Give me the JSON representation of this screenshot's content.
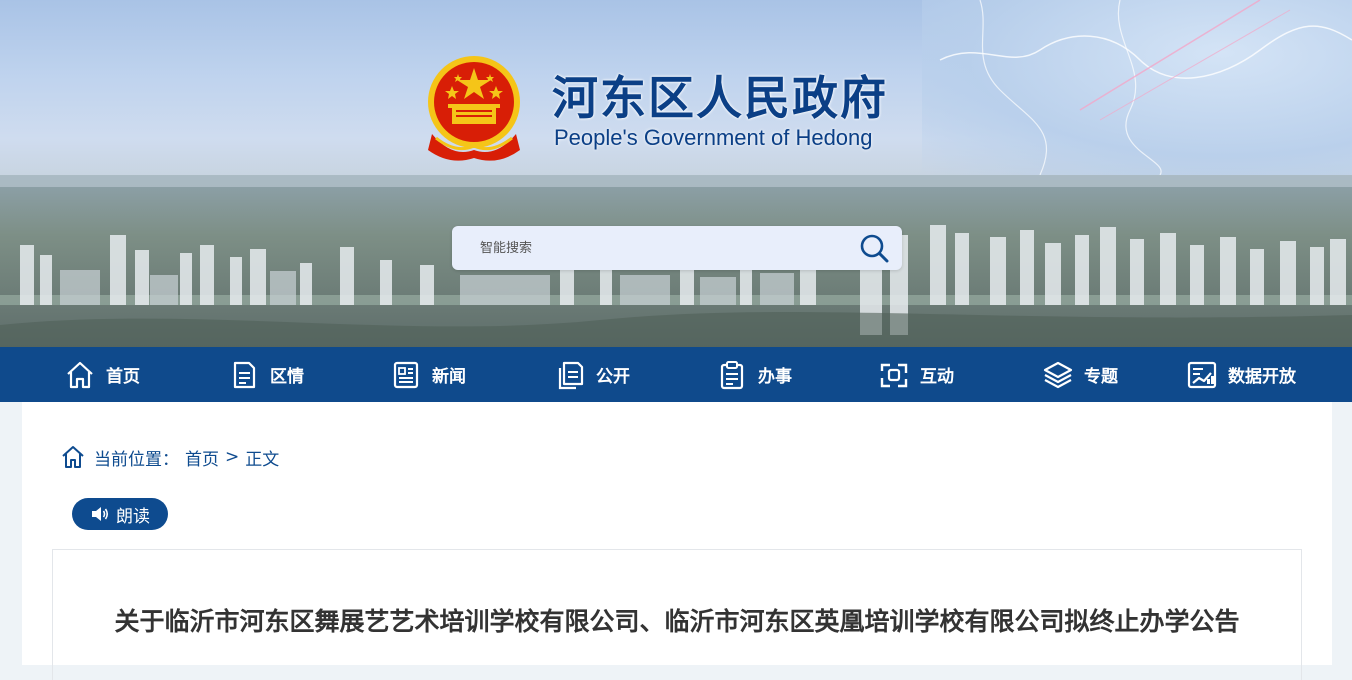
{
  "header": {
    "title_cn": "河东区人民政府",
    "title_en": "People's Government of Hedong"
  },
  "search": {
    "placeholder": "智能搜索",
    "icon": "search-icon"
  },
  "nav": {
    "items": [
      {
        "label": "首页",
        "icon": "home-icon"
      },
      {
        "label": "区情",
        "icon": "document-icon"
      },
      {
        "label": "新闻",
        "icon": "newspaper-icon"
      },
      {
        "label": "公开",
        "icon": "files-icon"
      },
      {
        "label": "办事",
        "icon": "clipboard-icon"
      },
      {
        "label": "互动",
        "icon": "interaction-icon"
      },
      {
        "label": "专题",
        "icon": "layers-icon"
      },
      {
        "label": "数据开放",
        "icon": "data-chart-icon"
      }
    ]
  },
  "breadcrumb": {
    "prefix": "当前位置：",
    "home": "首页",
    "separator": ">",
    "current": "正文"
  },
  "read_button": {
    "label": "朗读",
    "icon": "speaker-icon"
  },
  "article": {
    "title": "关于临沂市河东区舞展艺艺术培训学校有限公司、临沂市河东区英凰培训学校有限公司拟终止办学公告"
  },
  "colors": {
    "primary": "#0f4a8c",
    "title_blue": "#0b3f86",
    "emblem_red": "#d81e06",
    "emblem_gold": "#f5c518"
  }
}
